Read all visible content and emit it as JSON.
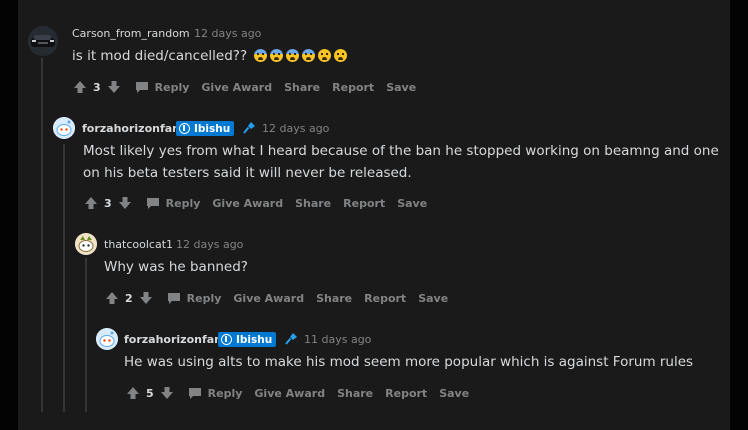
{
  "comments": [
    {
      "username": "Carson_from_random",
      "time": "12 days ago",
      "body": "is it mod died/cancelled??",
      "emoji_icons": [
        "scream-emoji",
        "scream-emoji",
        "fearful-emoji",
        "fearful-emoji",
        "disappointed-emoji",
        "disappointed-emoji"
      ],
      "votes": "3",
      "avatar_icon": "car-avatar-icon"
    },
    {
      "username": "forzahorizonfan",
      "flair": "Ibishu",
      "time": "12 days ago",
      "body_line1": "Most likely yes from what I heard because of the ban he stopped working on beamng and one",
      "body_line2": "on his beta testers said it will never be released.",
      "votes": "3",
      "avatar_icon": "snoo-avatar-icon"
    },
    {
      "username": "thatcoolcat1",
      "time": "12 days ago",
      "body": "Why was he banned?",
      "votes": "2",
      "avatar_icon": "snoo-avatar-icon"
    },
    {
      "username": "forzahorizonfan",
      "flair": "Ibishu",
      "time": "11 days ago",
      "body": "He was using alts to make his mod seem more popular which is against Forum rules",
      "votes": "5",
      "avatar_icon": "snoo-avatar-icon"
    }
  ],
  "actions": {
    "reply": "Reply",
    "give_award": "Give Award",
    "share": "Share",
    "report": "Report",
    "save": "Save"
  },
  "colors": {
    "background": "#1a1a1b",
    "text": "#d7dadc",
    "muted": "#818384",
    "flair": "#0079d3",
    "mod": "#24a0ed"
  }
}
